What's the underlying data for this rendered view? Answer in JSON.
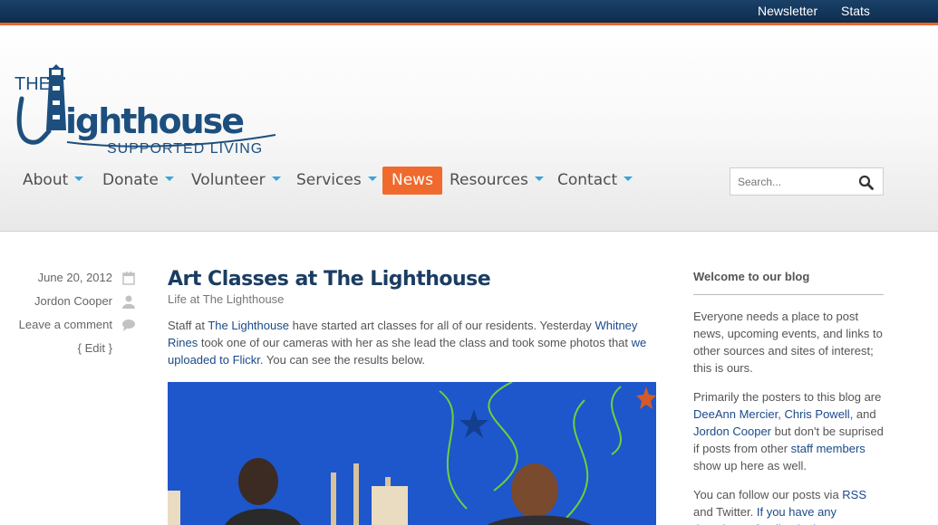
{
  "topbar": {
    "links": [
      "Newsletter",
      "Stats"
    ]
  },
  "logo": {
    "text_the": "THE",
    "text_main": "LIGHTHOUSE",
    "text_sub": "SUPPORTED LIVING"
  },
  "nav": {
    "items": [
      {
        "label": "About",
        "dropdown": true
      },
      {
        "label": "Donate",
        "dropdown": true
      },
      {
        "label": "Volunteer",
        "dropdown": true
      },
      {
        "label": "Services",
        "dropdown": true
      },
      {
        "label": "News",
        "dropdown": false,
        "active": true
      },
      {
        "label": "Resources",
        "dropdown": true
      },
      {
        "label": "Contact",
        "dropdown": true
      }
    ]
  },
  "search": {
    "placeholder": "Search..."
  },
  "post": {
    "date": "June 20, 2012",
    "author": "Jordon Cooper",
    "comment_link": "Leave a comment",
    "edit_open": "{ ",
    "edit_label": "Edit",
    "edit_close": " }",
    "title": "Art Classes at The Lighthouse",
    "category": "Life at The Lighthouse",
    "body": {
      "t1": "Staff at ",
      "l1": "The Lighthouse",
      "t2": " have started art classes for all of our residents.  Yesterday ",
      "l2": "Whitney Rines",
      "t3": " took one of our cameras with her as she lead the class and took some photos that ",
      "l3": "we uploaded to Flickr",
      "t4": ".  You can see the results below."
    }
  },
  "sidebar": {
    "heading": "Welcome to our blog",
    "p1": "Everyone needs a place to post news, upcoming events, and links to other sources and sites of interest; this is ours.",
    "p2": {
      "t1": "Primarily the posters to this blog are ",
      "l1": "DeeAnn Mercier",
      "t2": ", ",
      "l2": "Chris Powell",
      "t3": ", and ",
      "l3": "Jordon Cooper",
      "t4": " but don't be suprised if posts from other ",
      "l4": "staff members",
      "t5": " show up here as well."
    },
    "p3": {
      "t1": "You can follow our posts via ",
      "l1": "RSS",
      "t2": " and Twitter. ",
      "l2": "If you have any thoughts or feedback about"
    }
  },
  "colors": {
    "topbar": "#0e2c4e",
    "accent_orange": "#f06a2d",
    "nav_caret": "#3aa3d7",
    "title_blue": "#1b3d62",
    "link_blue": "#1a4a8a"
  }
}
